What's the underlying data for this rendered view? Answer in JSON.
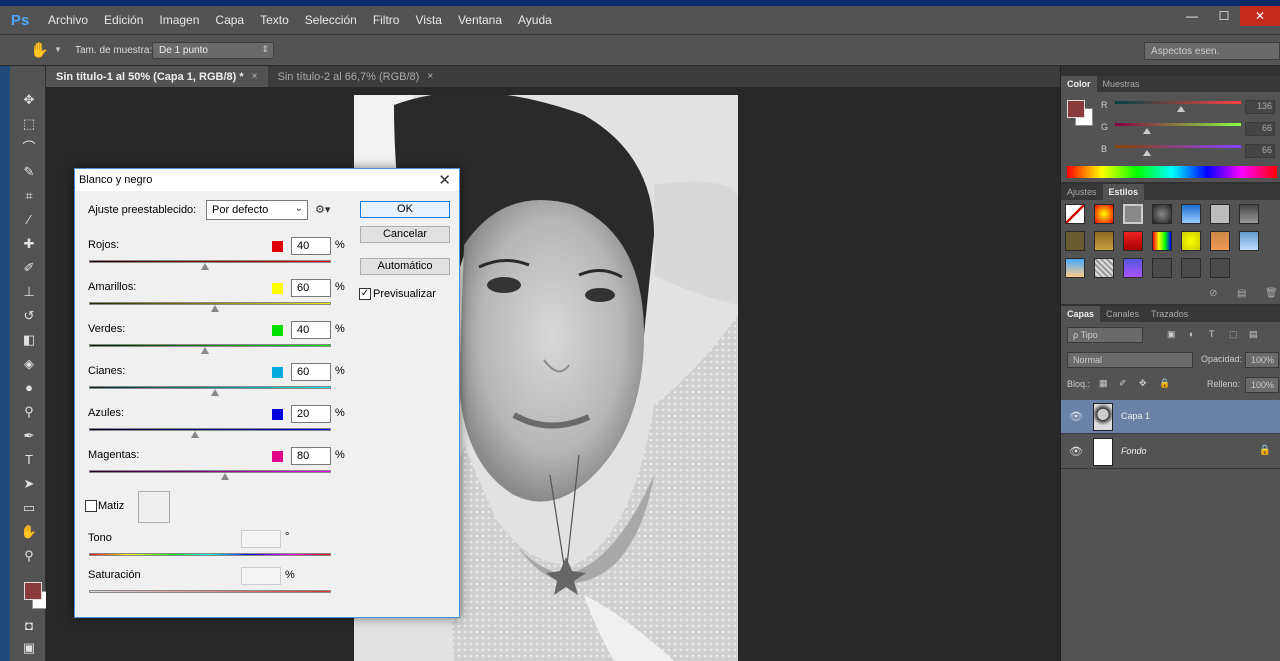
{
  "app": {
    "logo": "Ps"
  },
  "menu": [
    "Archivo",
    "Edición",
    "Imagen",
    "Capa",
    "Texto",
    "Selección",
    "Filtro",
    "Vista",
    "Ventana",
    "Ayuda"
  ],
  "window_controls": {
    "minimize": "—",
    "restore": "☐",
    "close": "✕"
  },
  "options_bar": {
    "sample_size_label": "Tam. de muestra:",
    "sample_size_value": "De 1 punto",
    "workspace_value": "Aspectos esen."
  },
  "tabs": [
    {
      "label": "Sin título-1 al 50% (Capa 1, RGB/8) *",
      "close": "×"
    },
    {
      "label": "Sin título-2 al 66,7% (RGB/8)",
      "close": "×"
    }
  ],
  "color_panel": {
    "tabs": [
      "Color",
      "Muestras"
    ],
    "fg_color": "#8b3b3b",
    "r": {
      "label": "R",
      "value": "136"
    },
    "g": {
      "label": "G",
      "value": "66"
    },
    "b": {
      "label": "B",
      "value": "66"
    }
  },
  "styles_panel": {
    "tabs": [
      "Ajustes",
      "Estilos"
    ]
  },
  "layers_panel": {
    "tabs": [
      "Capas",
      "Canales",
      "Trazados"
    ],
    "filter_value": "ρ Tipo",
    "blend_mode": "Normal",
    "opacity_label": "Opacidad:",
    "opacity_value": "100%",
    "lock_label": "Bloq.:",
    "fill_label": "Relleno:",
    "fill_value": "100%",
    "layers": [
      {
        "name": "Capa 1"
      },
      {
        "name": "Fondo"
      }
    ]
  },
  "dialog": {
    "title": "Blanco y negro",
    "close": "✕",
    "preset_label": "Ajuste preestablecido:",
    "preset_value": "Por defecto",
    "buttons": {
      "ok": "OK",
      "cancel": "Cancelar",
      "auto": "Automático"
    },
    "preview": {
      "label": "Previsualizar",
      "checked": true
    },
    "sliders": [
      {
        "label": "Rojos:",
        "value": "40",
        "unit": "%",
        "color": "#e00000",
        "fraction": 0.48,
        "gradient": "linear-gradient(to right, #200, #e00)"
      },
      {
        "label": "Amarillos:",
        "value": "60",
        "unit": "%",
        "color": "#ffff00",
        "fraction": 0.52,
        "gradient": "linear-gradient(to right, #220, #ee0)"
      },
      {
        "label": "Verdes:",
        "value": "40",
        "unit": "%",
        "color": "#00e000",
        "fraction": 0.48,
        "gradient": "linear-gradient(to right, #020, #0e0)"
      },
      {
        "label": "Cianes:",
        "value": "60",
        "unit": "%",
        "color": "#00aadd",
        "fraction": 0.52,
        "gradient": "linear-gradient(to right, #022, #0ee)"
      },
      {
        "label": "Azules:",
        "value": "20",
        "unit": "%",
        "color": "#0000dd",
        "fraction": 0.44,
        "gradient": "linear-gradient(to right, #002, #00e)"
      },
      {
        "label": "Magentas:",
        "value": "80",
        "unit": "%",
        "color": "#e0008a",
        "fraction": 0.56,
        "gradient": "linear-gradient(to right, #202, #e0e)"
      }
    ],
    "matiz": {
      "label": "Matiz",
      "checked": false
    },
    "tono": {
      "label": "Tono",
      "unit": "°"
    },
    "saturacion": {
      "label": "Saturación",
      "unit": "%"
    }
  }
}
